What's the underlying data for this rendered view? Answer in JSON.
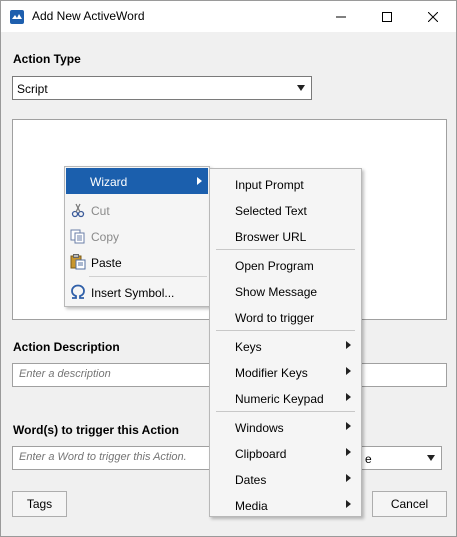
{
  "window": {
    "title": "Add New ActiveWord",
    "controls": [
      "minimize-icon",
      "maximize-icon",
      "close-icon"
    ]
  },
  "action_type": {
    "label": "Action Type",
    "selected": "Script"
  },
  "action_description": {
    "label": "Action Description",
    "placeholder": "Enter a description"
  },
  "trigger": {
    "label": "Word(s) to trigger this Action",
    "placeholder": "Enter a Word to trigger this Action.",
    "combo_partial_text": "e"
  },
  "buttons": {
    "tags": "Tags",
    "cancel": "Cancel"
  },
  "context_menu": {
    "items": [
      {
        "label": "Wizard",
        "icon": "none",
        "highlighted": true,
        "submenu": true
      },
      {
        "label": "Cut",
        "icon": "scissors-icon",
        "disabled": true
      },
      {
        "label": "Copy",
        "icon": "copy-icon",
        "disabled": true
      },
      {
        "label": "Paste",
        "icon": "paste-icon",
        "disabled": false
      },
      {
        "label": "Insert Symbol...",
        "icon": "omega-icon",
        "disabled": false
      }
    ]
  },
  "wizard_submenu": {
    "items": [
      {
        "label": "Input Prompt",
        "submenu": false
      },
      {
        "label": "Selected Text",
        "submenu": false
      },
      {
        "label": "Broswer URL",
        "submenu": false
      },
      {
        "label": "Open Program",
        "submenu": false
      },
      {
        "label": "Show Message",
        "submenu": false
      },
      {
        "label": "Word to trigger",
        "submenu": false
      },
      {
        "label": "Keys",
        "submenu": true
      },
      {
        "label": "Modifier Keys",
        "submenu": true
      },
      {
        "label": "Numeric Keypad",
        "submenu": true
      },
      {
        "label": "Windows",
        "submenu": true
      },
      {
        "label": "Clipboard",
        "submenu": true
      },
      {
        "label": "Dates",
        "submenu": true
      },
      {
        "label": "Media",
        "submenu": true
      }
    ]
  },
  "colors": {
    "highlight": "#1b5fad",
    "dialog_bg": "#f0f0f0",
    "menu_bg": "#f5f5f5"
  }
}
